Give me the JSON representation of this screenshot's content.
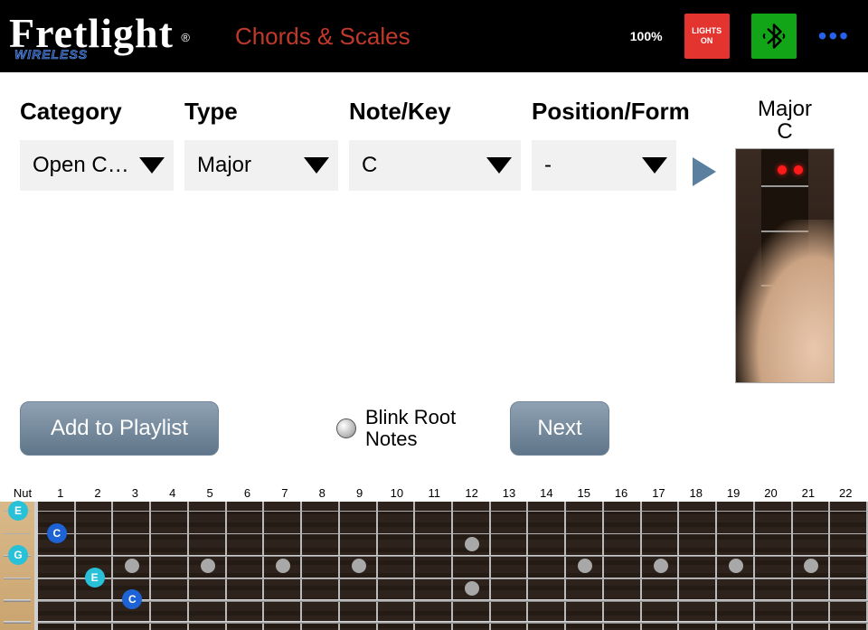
{
  "header": {
    "logo_main": "Fretlight",
    "logo_reg": "®",
    "logo_sub": "WIRELESS",
    "app_title": "Chords & Scales",
    "zoom_pct": "100%",
    "lights_btn_line1": "LIGHTS",
    "lights_btn_line2": "ON"
  },
  "selectors": {
    "category_label": "Category",
    "category_value": "Open Ch...",
    "type_label": "Type",
    "type_value": "Major",
    "note_label": "Note/Key",
    "note_value": "C",
    "position_label": "Position/Form",
    "position_value": "-"
  },
  "actions": {
    "add_playlist": "Add to Playlist",
    "blink_root": "Blink Root Notes",
    "next": "Next"
  },
  "preview": {
    "line1": "Major",
    "line2": "C"
  },
  "fretboard": {
    "nut_label": "Nut",
    "fret_numbers": [
      "1",
      "2",
      "3",
      "4",
      "5",
      "6",
      "7",
      "8",
      "9",
      "10",
      "11",
      "12",
      "13",
      "14",
      "15",
      "16",
      "17",
      "18",
      "19",
      "20",
      "21",
      "22"
    ],
    "string_count": 6,
    "inlay_single": [
      3,
      5,
      7,
      9,
      15,
      17,
      19,
      21
    ],
    "inlay_double": [
      12
    ],
    "open_notes": [
      {
        "string": 1,
        "label": "E",
        "kind": "root"
      },
      {
        "string": 3,
        "label": "G",
        "kind": "root"
      }
    ],
    "fretted_notes": [
      {
        "string": 2,
        "fret": 1,
        "label": "C",
        "kind": "tone"
      },
      {
        "string": 4,
        "fret": 2,
        "label": "E",
        "kind": "root"
      },
      {
        "string": 5,
        "fret": 3,
        "label": "C",
        "kind": "tone"
      }
    ]
  }
}
